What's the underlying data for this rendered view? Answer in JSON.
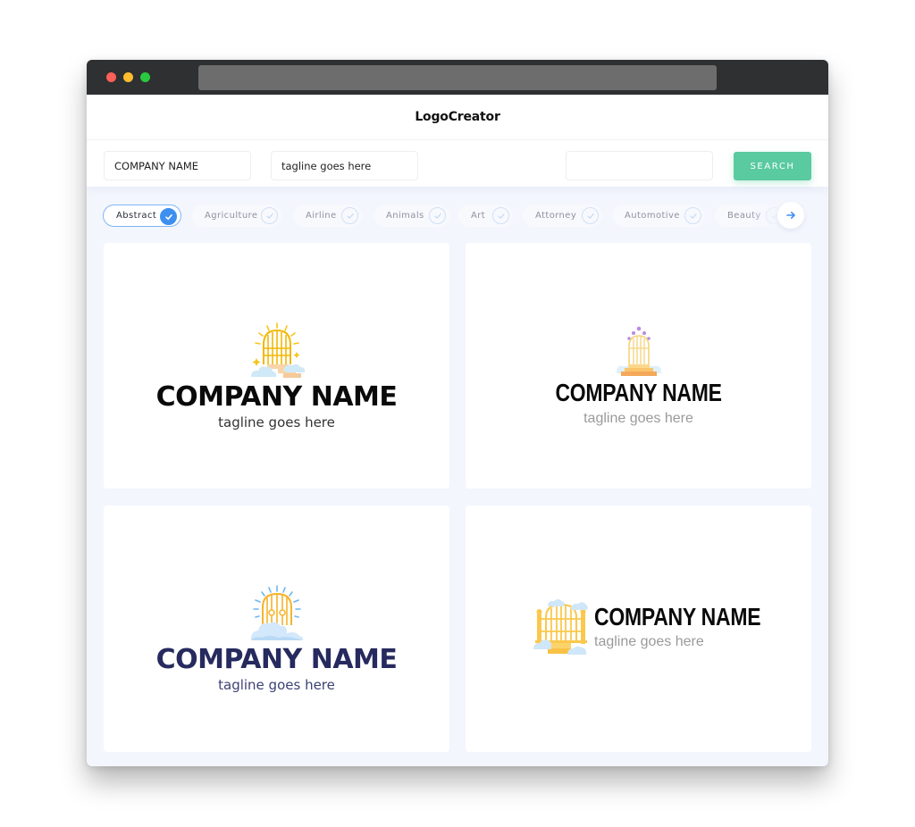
{
  "window": {
    "traffic_lights": [
      "close",
      "minimize",
      "maximize"
    ]
  },
  "header": {
    "title": "LogoCreator"
  },
  "search": {
    "company_value": "COMPANY NAME",
    "tagline_value": "tagline goes here",
    "keyword_value": "",
    "button_label": "SEARCH"
  },
  "categories": [
    {
      "label": "Abstract",
      "selected": true
    },
    {
      "label": "Agriculture",
      "selected": false
    },
    {
      "label": "Airline",
      "selected": false
    },
    {
      "label": "Animals",
      "selected": false
    },
    {
      "label": "Art",
      "selected": false
    },
    {
      "label": "Attorney",
      "selected": false
    },
    {
      "label": "Automotive",
      "selected": false
    },
    {
      "label": "Beauty",
      "selected": false
    }
  ],
  "next_icon": "arrow-right-icon",
  "colors": {
    "accent_blue": "#3d8ff0",
    "search_green": "#5acaa0",
    "navy_text": "#262a5e",
    "page_bg": "#f3f6fd"
  },
  "logos": [
    {
      "company": "COMPANY NAME",
      "tagline": "tagline goes here",
      "icon": "heaven-gate-sun-clouds-icon",
      "layout": "stacked"
    },
    {
      "company": "COMPANY NAME",
      "tagline": "tagline goes here",
      "icon": "heaven-gate-stairs-icon",
      "layout": "stacked"
    },
    {
      "company": "COMPANY NAME",
      "tagline": "tagline goes here",
      "icon": "heaven-gate-sunrays-clouds-icon",
      "layout": "stacked"
    },
    {
      "company": "COMPANY NAME",
      "tagline": "tagline goes here",
      "icon": "heaven-gate-fence-clouds-icon",
      "layout": "inline"
    }
  ]
}
